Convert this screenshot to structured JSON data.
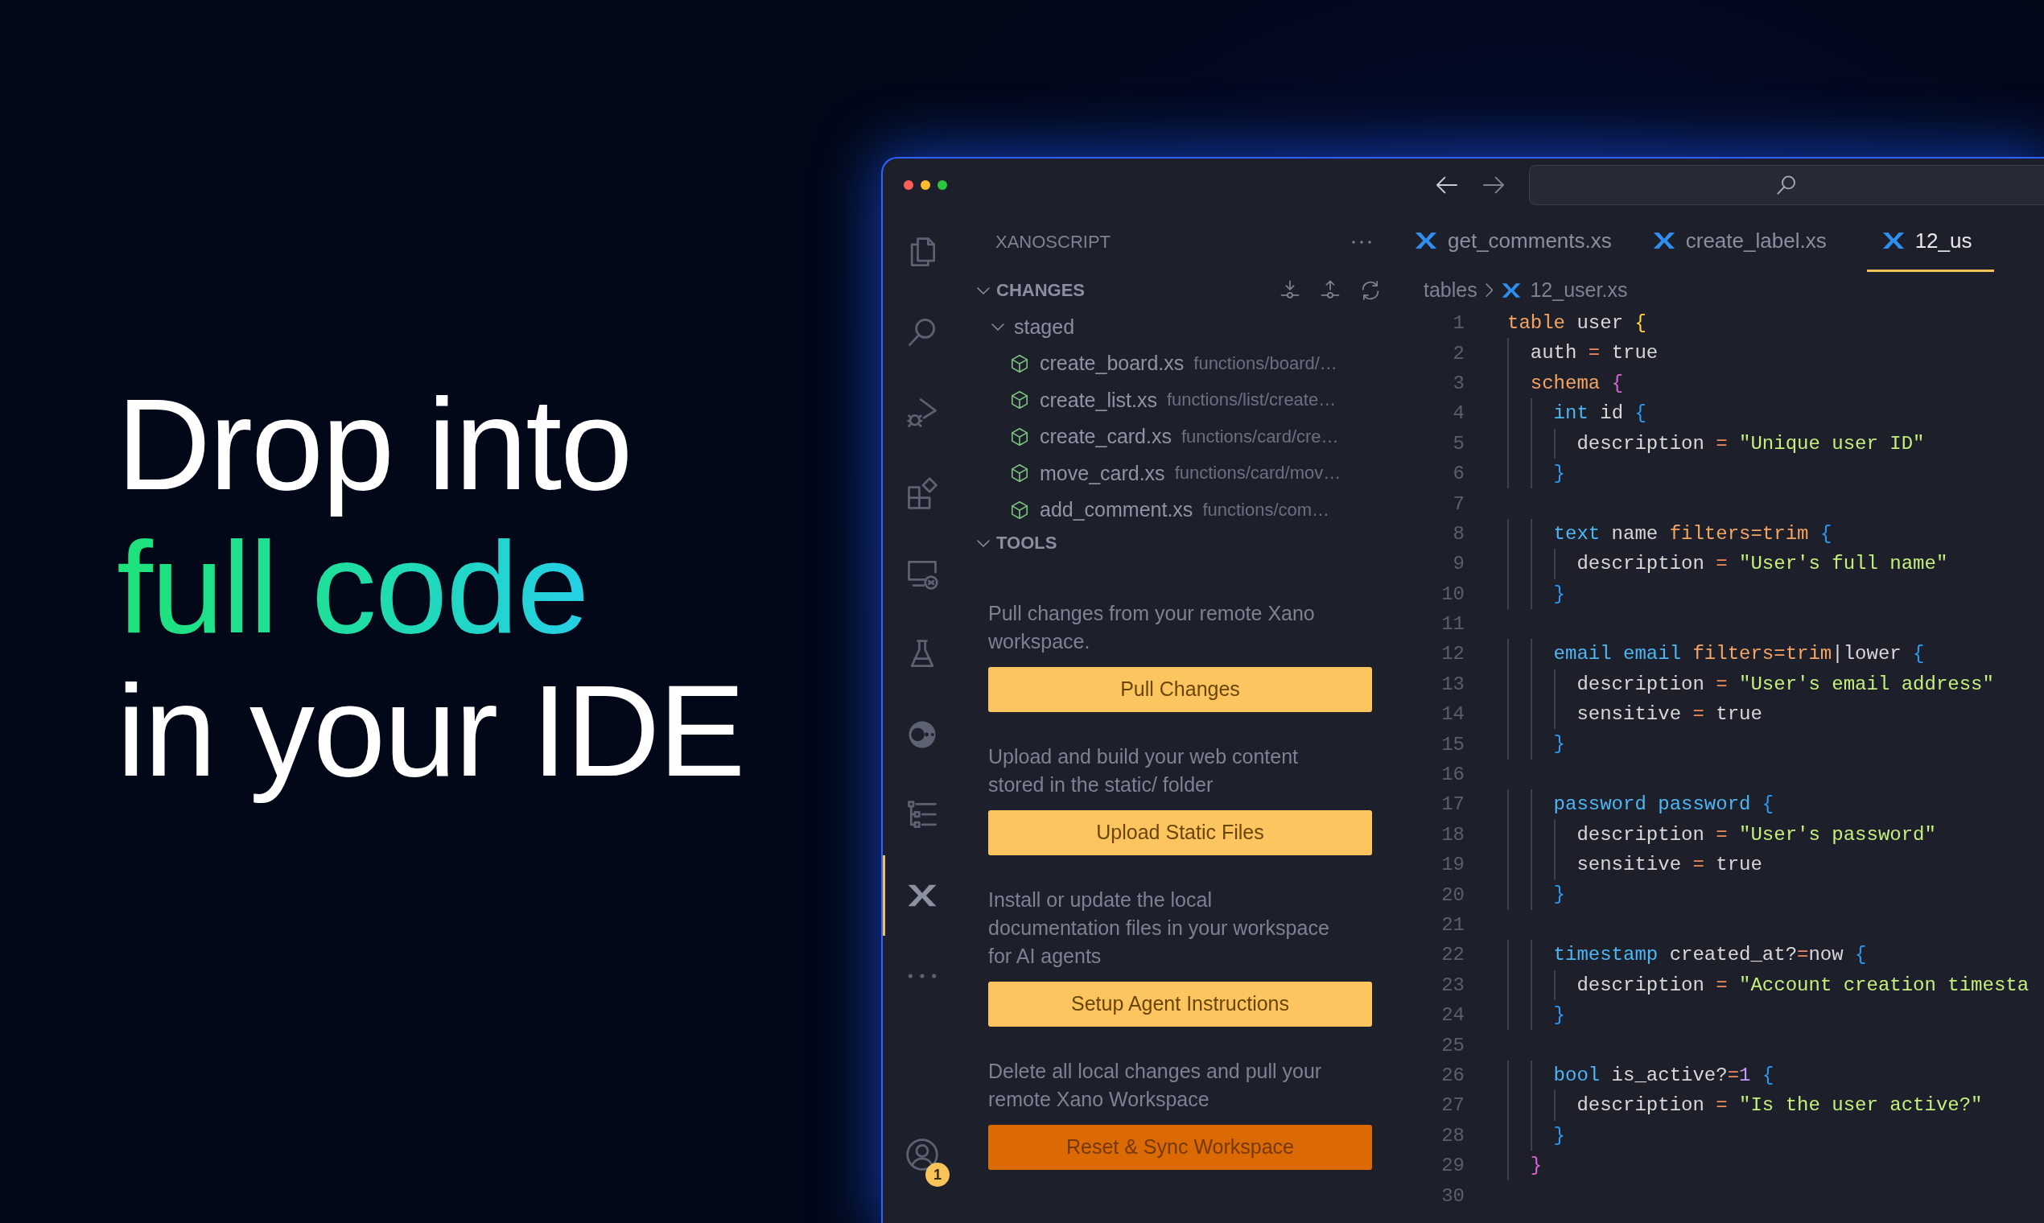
{
  "headline": [
    {
      "text": "Drop into",
      "kind": "plain"
    },
    {
      "text": "full code",
      "kind": "gradient"
    },
    {
      "text": "in your IDE",
      "kind": "plain"
    }
  ],
  "activity_bar": [
    {
      "kind": "files",
      "selected": false
    },
    {
      "kind": "search",
      "selected": false
    },
    {
      "kind": "debug",
      "selected": false
    },
    {
      "kind": "extensions",
      "selected": false
    },
    {
      "kind": "remote",
      "selected": false
    },
    {
      "kind": "flask",
      "selected": false
    },
    {
      "kind": "orbit",
      "selected": false
    },
    {
      "kind": "tree",
      "selected": false
    },
    {
      "kind": "xano",
      "selected": true
    },
    {
      "kind": "more",
      "selected": false
    },
    {
      "kind": "account",
      "selected": false,
      "badge": "1"
    }
  ],
  "sidebar": {
    "title": "XANOSCRIPT",
    "changes": {
      "title": "CHANGES",
      "expanded": true,
      "groups": [
        {
          "label": "staged",
          "expanded": true,
          "files": [
            {
              "name": "create_board.xs",
              "path": "functions/board/…"
            },
            {
              "name": "create_list.xs",
              "path": "functions/list/create…"
            },
            {
              "name": "create_card.xs",
              "path": "functions/card/cre…"
            },
            {
              "name": "move_card.xs",
              "path": "functions/card/mov…"
            },
            {
              "name": "add_comment.xs",
              "path": "functions/com…"
            }
          ]
        }
      ]
    },
    "tools": {
      "title": "TOOLS",
      "expanded": true,
      "actions": [
        {
          "description": "Pull changes from your remote Xano workspace.",
          "button": "Pull Changes",
          "kind": "primary"
        },
        {
          "description": "Upload and build your web content stored in the static/ folder",
          "button": "Upload Static Files",
          "kind": "primary"
        },
        {
          "description": "Install or update the local documentation files in your workspace for AI agents",
          "button": "Setup Agent Instructions",
          "kind": "primary"
        },
        {
          "description": "Delete all local changes and pull your remote Xano Workspace",
          "button": "Reset & Sync Workspace",
          "kind": "danger"
        }
      ]
    }
  },
  "tabs": [
    {
      "label": "get_comments.xs",
      "selected": false
    },
    {
      "label": "create_label.xs",
      "selected": false
    },
    {
      "label": "12_us",
      "selected": true
    }
  ],
  "breadcrumb": [
    "tables",
    "12_user.xs"
  ],
  "code": [
    {
      "number": "1",
      "tokens": [
        {
          "text": "table",
          "kind": "keyword"
        },
        {
          "text": " user ",
          "kind": "plain"
        },
        {
          "text": "{",
          "kind": "brace1"
        }
      ]
    },
    {
      "number": "2",
      "tokens": [
        {
          "text": "  auth ",
          "kind": "plain"
        },
        {
          "text": "=",
          "kind": "operator"
        },
        {
          "text": " true",
          "kind": "plain"
        }
      ]
    },
    {
      "number": "3",
      "tokens": [
        {
          "text": "  schema ",
          "kind": "keyword"
        },
        {
          "text": "{",
          "kind": "brace2"
        }
      ]
    },
    {
      "number": "4",
      "tokens": [
        {
          "text": "    int",
          "kind": "type"
        },
        {
          "text": " id ",
          "kind": "plain"
        },
        {
          "text": "{",
          "kind": "brace3"
        }
      ]
    },
    {
      "number": "5",
      "tokens": [
        {
          "text": "      description ",
          "kind": "plain"
        },
        {
          "text": "=",
          "kind": "operator"
        },
        {
          "text": " \"Unique user ID\"",
          "kind": "string"
        }
      ]
    },
    {
      "number": "6",
      "tokens": [
        {
          "text": "    }",
          "kind": "brace3"
        }
      ]
    },
    {
      "number": "7"
    },
    {
      "number": "8",
      "tokens": [
        {
          "text": "    text",
          "kind": "type"
        },
        {
          "text": " name ",
          "kind": "plain"
        },
        {
          "text": "filters=trim ",
          "kind": "keyword"
        },
        {
          "text": "{",
          "kind": "brace3"
        }
      ]
    },
    {
      "number": "9",
      "tokens": [
        {
          "text": "      description ",
          "kind": "plain"
        },
        {
          "text": "=",
          "kind": "operator"
        },
        {
          "text": " \"User's full name\"",
          "kind": "string"
        }
      ]
    },
    {
      "number": "10",
      "tokens": [
        {
          "text": "    }",
          "kind": "brace3"
        }
      ]
    },
    {
      "number": "11"
    },
    {
      "number": "12",
      "tokens": [
        {
          "text": "    email email ",
          "kind": "type"
        },
        {
          "text": "filters=trim",
          "kind": "keyword"
        },
        {
          "text": "|lower ",
          "kind": "plain"
        },
        {
          "text": "{",
          "kind": "brace3"
        }
      ]
    },
    {
      "number": "13",
      "tokens": [
        {
          "text": "      description ",
          "kind": "plain"
        },
        {
          "text": "=",
          "kind": "operator"
        },
        {
          "text": " \"User's email address\"",
          "kind": "string"
        }
      ]
    },
    {
      "number": "14",
      "tokens": [
        {
          "text": "      sensitive ",
          "kind": "plain"
        },
        {
          "text": "=",
          "kind": "operator"
        },
        {
          "text": " true",
          "kind": "plain"
        }
      ]
    },
    {
      "number": "15",
      "tokens": [
        {
          "text": "    }",
          "kind": "brace3"
        }
      ]
    },
    {
      "number": "16"
    },
    {
      "number": "17",
      "tokens": [
        {
          "text": "    password password ",
          "kind": "type"
        },
        {
          "text": "{",
          "kind": "brace3"
        }
      ]
    },
    {
      "number": "18",
      "tokens": [
        {
          "text": "      description ",
          "kind": "plain"
        },
        {
          "text": "=",
          "kind": "operator"
        },
        {
          "text": " \"User's password\"",
          "kind": "string"
        }
      ]
    },
    {
      "number": "19",
      "tokens": [
        {
          "text": "      sensitive ",
          "kind": "plain"
        },
        {
          "text": "=",
          "kind": "operator"
        },
        {
          "text": " true",
          "kind": "plain"
        }
      ]
    },
    {
      "number": "20",
      "tokens": [
        {
          "text": "    }",
          "kind": "brace3"
        }
      ]
    },
    {
      "number": "21"
    },
    {
      "number": "22",
      "tokens": [
        {
          "text": "    timestamp",
          "kind": "type"
        },
        {
          "text": " created_at?",
          "kind": "plain"
        },
        {
          "text": "=",
          "kind": "operator"
        },
        {
          "text": "now ",
          "kind": "plain"
        },
        {
          "text": "{",
          "kind": "brace3"
        }
      ]
    },
    {
      "number": "23",
      "tokens": [
        {
          "text": "      description ",
          "kind": "plain"
        },
        {
          "text": "=",
          "kind": "operator"
        },
        {
          "text": " \"Account creation timesta",
          "kind": "string"
        }
      ]
    },
    {
      "number": "24",
      "tokens": [
        {
          "text": "    }",
          "kind": "brace3"
        }
      ]
    },
    {
      "number": "25"
    },
    {
      "number": "26",
      "tokens": [
        {
          "text": "    bool",
          "kind": "type"
        },
        {
          "text": " is_active?",
          "kind": "plain"
        },
        {
          "text": "=",
          "kind": "operator"
        },
        {
          "text": "1 ",
          "kind": "number"
        },
        {
          "text": "{",
          "kind": "brace3"
        }
      ]
    },
    {
      "number": "27",
      "tokens": [
        {
          "text": "      description ",
          "kind": "plain"
        },
        {
          "text": "=",
          "kind": "operator"
        },
        {
          "text": " \"Is the user active?\"",
          "kind": "string"
        }
      ]
    },
    {
      "number": "28",
      "tokens": [
        {
          "text": "    }",
          "kind": "brace3"
        }
      ]
    },
    {
      "number": "29",
      "tokens": [
        {
          "text": "  }",
          "kind": "brace2"
        }
      ]
    },
    {
      "number": "30"
    }
  ]
}
